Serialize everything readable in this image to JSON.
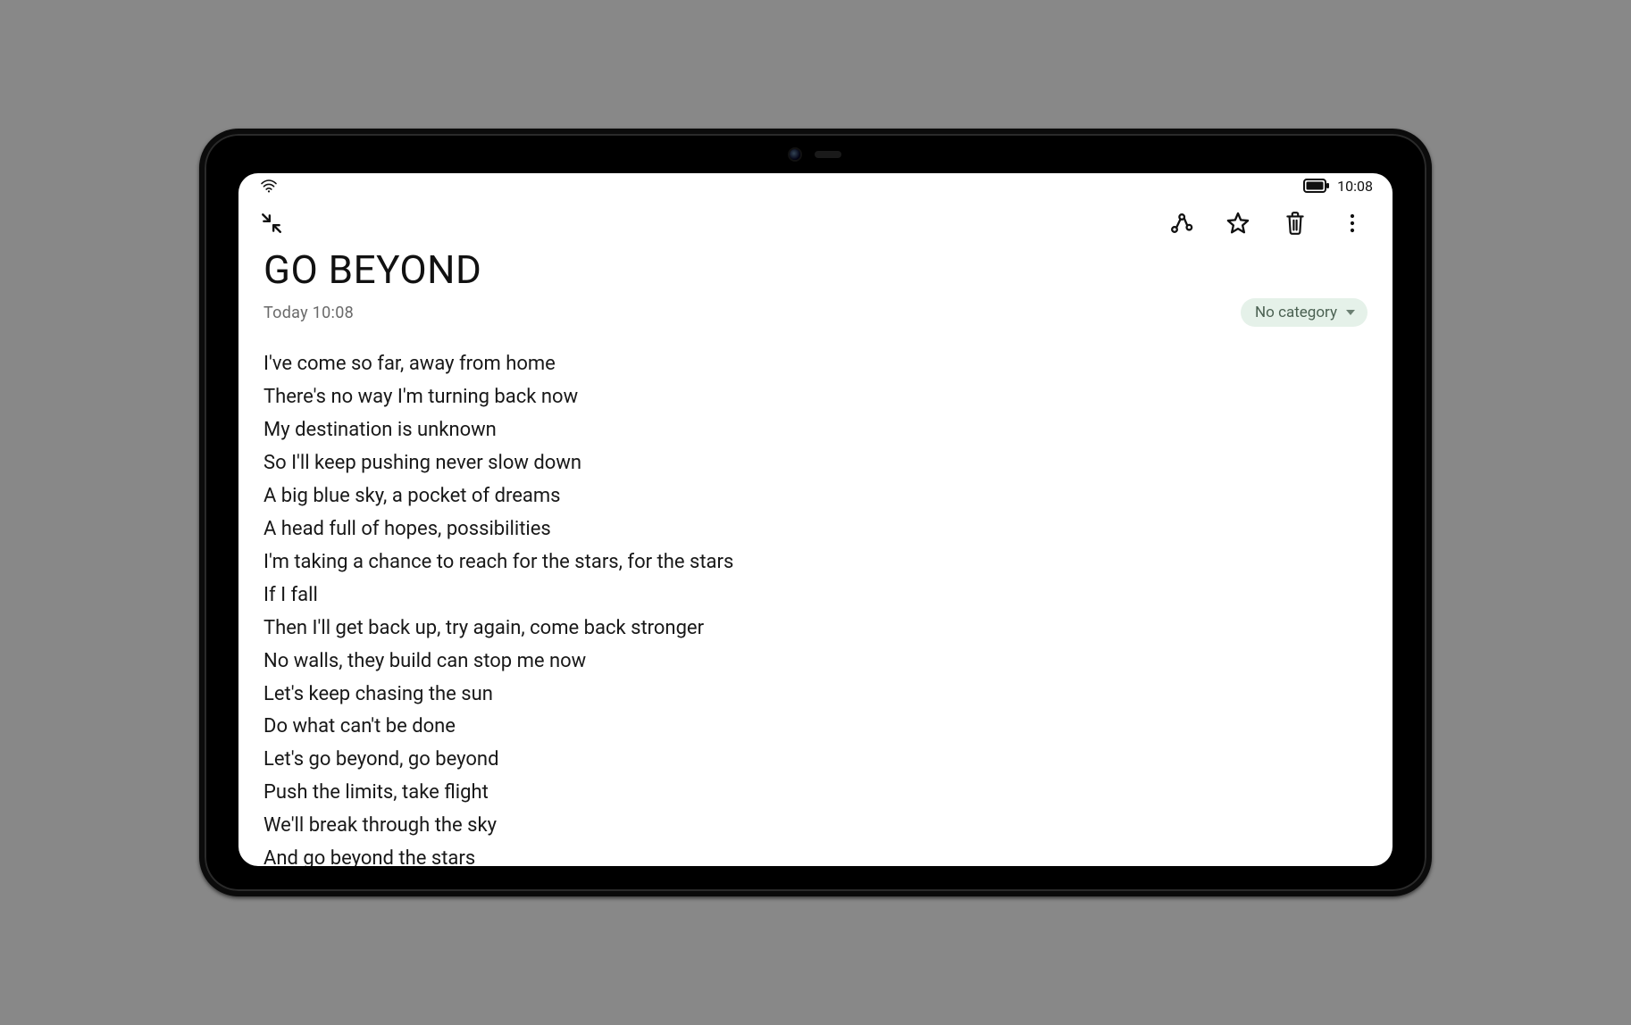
{
  "statusbar": {
    "time": "10:08"
  },
  "note": {
    "title": "GO BEYOND",
    "timestamp": "Today 10:08",
    "category_label": "No category",
    "lines": [
      "I've come so far, away from home",
      "There's no way I'm turning back now",
      "My destination is unknown",
      "So I'll keep pushing never slow down",
      "A big blue sky, a pocket of dreams",
      "A head full of hopes, possibilities",
      "I'm taking a chance to reach for the stars, for the stars",
      "If I fall",
      "Then I'll get back up, try again, come back stronger",
      "No walls, they build can stop me now",
      "Let's keep chasing the sun",
      "Do what can't be done",
      "Let's go beyond, go beyond",
      "Push the limits, take flight",
      "We'll break through the sky",
      "And go beyond the stars"
    ]
  }
}
